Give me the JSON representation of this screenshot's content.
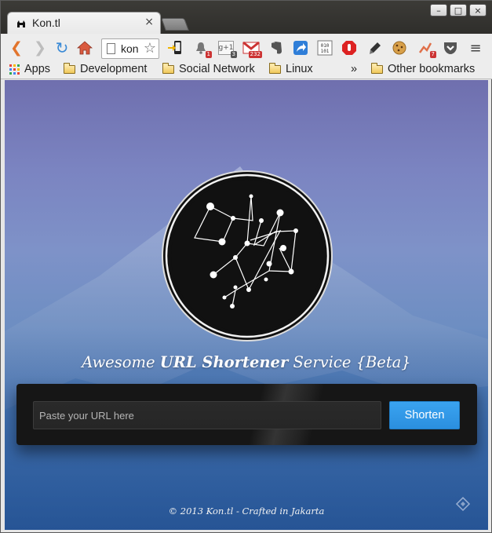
{
  "browser": {
    "tab_title": "Kon.tl",
    "tab_close": "×",
    "omnibox_text": "kon",
    "window_buttons": [
      "–",
      "□",
      "×"
    ],
    "extension_badges": {
      "notifications": "1",
      "gplus": "3",
      "gmail": "232",
      "tools": "7"
    }
  },
  "bookmarks": {
    "apps": "Apps",
    "items": [
      "Development",
      "Social Network",
      "Linux"
    ],
    "overflow": "»",
    "other": "Other bookmarks"
  },
  "page": {
    "tagline": {
      "pre": "Awesome",
      "bold": "URL Shortener",
      "post": "Service {Beta}"
    },
    "url_placeholder": "Paste your URL here",
    "shorten_label": "Shorten",
    "footer": "© 2013 Kon.tl - Crafted in Jakarta"
  },
  "colors": {
    "accent": "#2f95e6",
    "panel": "#161616"
  }
}
